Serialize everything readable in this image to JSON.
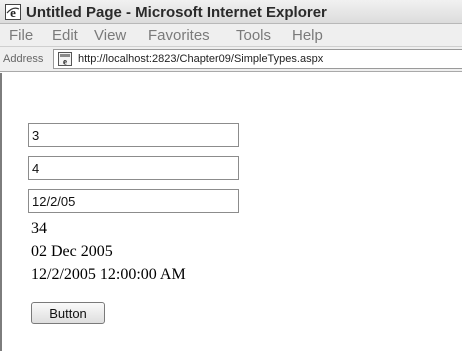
{
  "window": {
    "title": "Untitled Page - Microsoft Internet Explorer"
  },
  "menu": {
    "items": [
      "File",
      "Edit",
      "View",
      "Favorites",
      "Tools",
      "Help"
    ]
  },
  "address": {
    "label": "Address",
    "url": "http://localhost:2823/Chapter09/SimpleTypes.aspx"
  },
  "form": {
    "textboxes": [
      "3",
      "4",
      "12/2/05"
    ],
    "outputs": [
      "34",
      "02 Dec 2005",
      "12/2/2005 12:00:00 AM"
    ],
    "button_label": "Button"
  },
  "icons": {
    "title": "internet-explorer-icon",
    "page": "page-icon"
  }
}
